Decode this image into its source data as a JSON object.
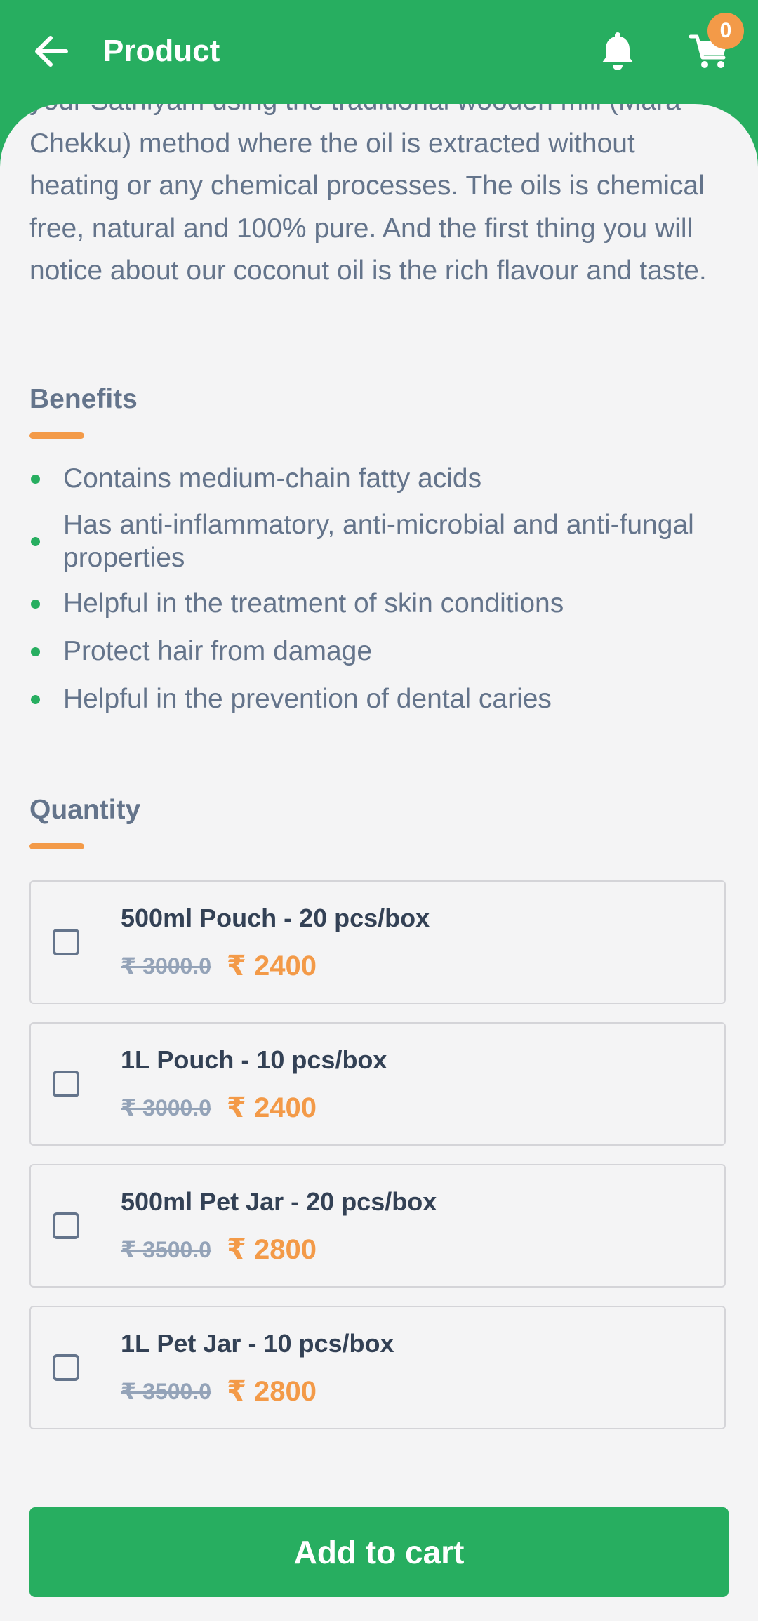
{
  "header": {
    "title": "Product",
    "back_icon": "arrow-left-icon",
    "notification_icon": "bell-icon",
    "cart_icon": "cart-icon",
    "cart_count": "0"
  },
  "description": {
    "text": "your Sathiyam using the traditional wooden mill (Mara Chekku) method where the oil is extracted without heating or any chemical processes. The oils is chemical free, natural and 100% pure. And the first thing you will notice about our coconut oil is the rich flavour and taste."
  },
  "benefits": {
    "heading": "Benefits",
    "items": [
      "Contains medium-chain fatty acids",
      "Has anti-inflammatory, anti-microbial and anti-fungal properties",
      "Helpful in the treatment of skin conditions",
      "Protect hair from damage",
      "Helpful in the prevention of dental caries"
    ]
  },
  "quantity": {
    "heading": "Quantity",
    "options": [
      {
        "name": "500ml Pouch - 20 pcs/box",
        "old_price": "₹ 3000.0",
        "price": "₹ 2400",
        "checked": false
      },
      {
        "name": "1L Pouch - 10 pcs/box",
        "old_price": "₹ 3000.0",
        "price": "₹ 2400",
        "checked": false
      },
      {
        "name": "500ml Pet Jar - 20 pcs/box",
        "old_price": "₹ 3500.0",
        "price": "₹ 2800",
        "checked": false
      },
      {
        "name": "1L Pet Jar - 10 pcs/box",
        "old_price": "₹ 3500.0",
        "price": "₹ 2800",
        "checked": false
      }
    ]
  },
  "actions": {
    "add_to_cart_label": "Add to cart"
  },
  "colors": {
    "primary_green": "#27ae60",
    "accent_orange": "#f39a48",
    "text_slate": "#64748b",
    "background": "#f4f4f5"
  }
}
